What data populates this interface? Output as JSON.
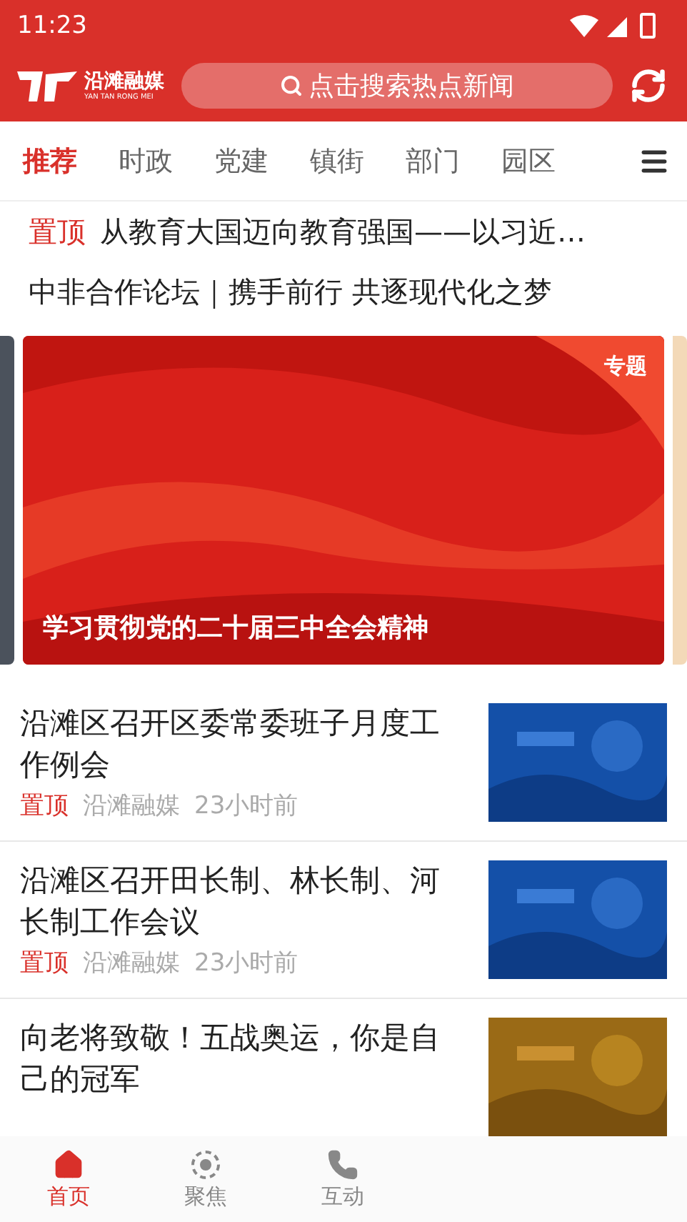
{
  "status_bar": {
    "time": "11:23"
  },
  "header": {
    "logo_text": "沿滩融媒",
    "logo_subtext": "YAN TAN RONG MEI",
    "search": {
      "placeholder": "点击搜索热点新闻"
    }
  },
  "tabs": [
    {
      "label": "推荐",
      "selected": true
    },
    {
      "label": "时政",
      "selected": false
    },
    {
      "label": "党建",
      "selected": false
    },
    {
      "label": "镇街",
      "selected": false
    },
    {
      "label": "部门",
      "selected": false
    },
    {
      "label": "园区",
      "selected": false
    }
  ],
  "headlines": [
    {
      "tag": "置顶",
      "title": "从教育大国迈向教育强国——以习近…"
    },
    {
      "title": "中非合作论坛｜携手前行 共逐现代化之梦"
    }
  ],
  "banner": {
    "badge": "专题",
    "caption": "学习贯彻党的二十届三中全会精神"
  },
  "news": [
    {
      "title": "沿滩区召开区委常委班子月度工作例会",
      "tag": "置顶",
      "source": "沿滩融媒",
      "time": "23小时前"
    },
    {
      "title": "沿滩区召开田长制、林长制、河长制工作会议",
      "tag": "置顶",
      "source": "沿滩融媒",
      "time": "23小时前"
    },
    {
      "title": "向老将致敬！五战奥运，你是自己的冠军"
    }
  ],
  "bottom_nav": [
    {
      "label": "首页",
      "selected": true
    },
    {
      "label": "聚焦",
      "selected": false
    },
    {
      "label": "互动",
      "selected": false
    }
  ]
}
